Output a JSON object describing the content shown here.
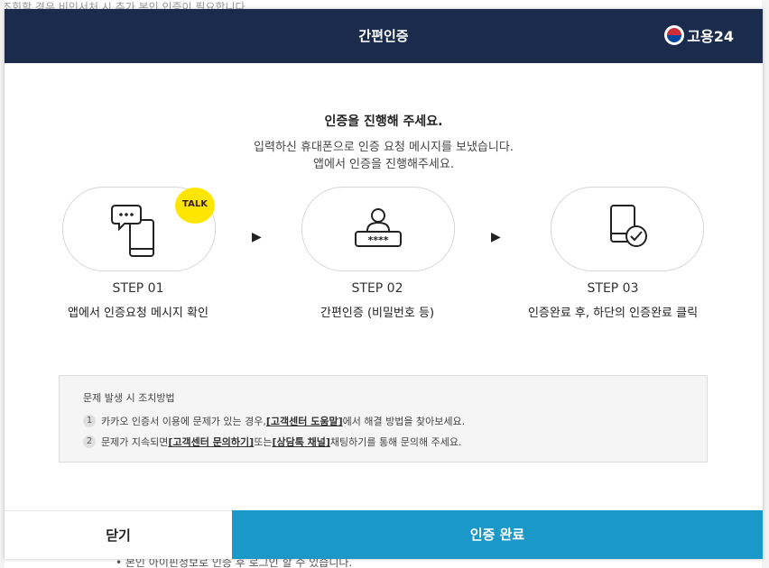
{
  "background": {
    "top_text": "조회할 경우 비인서처 시 추가 본인 인증이 필요합니다.",
    "bottom_text": "• 본인 아이핀정보로 인증 후 로그인 할 수 있습니다."
  },
  "header": {
    "title": "간편인증",
    "brand": "고용24"
  },
  "intro": {
    "lead": "인증을 진행해 주세요.",
    "line1": "입력하신 휴대폰으로 인증 요청 메시지를 보냈습니다.",
    "line2": "앱에서 인증을 진행해주세요."
  },
  "badge": {
    "label": "TALK"
  },
  "steps": [
    {
      "label": "STEP 01",
      "desc": "앱에서 인증요청 메시지 확인",
      "icon": "phone-chat-icon"
    },
    {
      "label": "STEP 02",
      "desc": "간편인증 (비밀번호 등)",
      "icon": "user-password-icon",
      "mask": "****"
    },
    {
      "label": "STEP 03",
      "desc": "인증완료 후, 하단의 인증완료 클릭",
      "icon": "phone-check-icon"
    }
  ],
  "help": {
    "title": "문제 발생 시 조치방법",
    "items": [
      {
        "num": "1",
        "before": "카카오 인증서 이용에 문제가 있는 경우, ",
        "link1": "[고객센터 도움말]",
        "after": " 에서 해결 방법을 찾아보세요."
      },
      {
        "num": "2",
        "before": "문제가 지속되면 ",
        "link1": "[고객센터 문의하기]",
        "middle": " 또는 ",
        "link2": "[상담톡 채널]",
        "after": " 채팅하기를 통해 문의해 주세요."
      }
    ]
  },
  "footer": {
    "close_label": "닫기",
    "confirm_label": "인증 완료"
  },
  "colors": {
    "header_bg": "#1b2b4b",
    "confirm_bg": "#1a98c8",
    "talk_badge": "#ffe600"
  }
}
